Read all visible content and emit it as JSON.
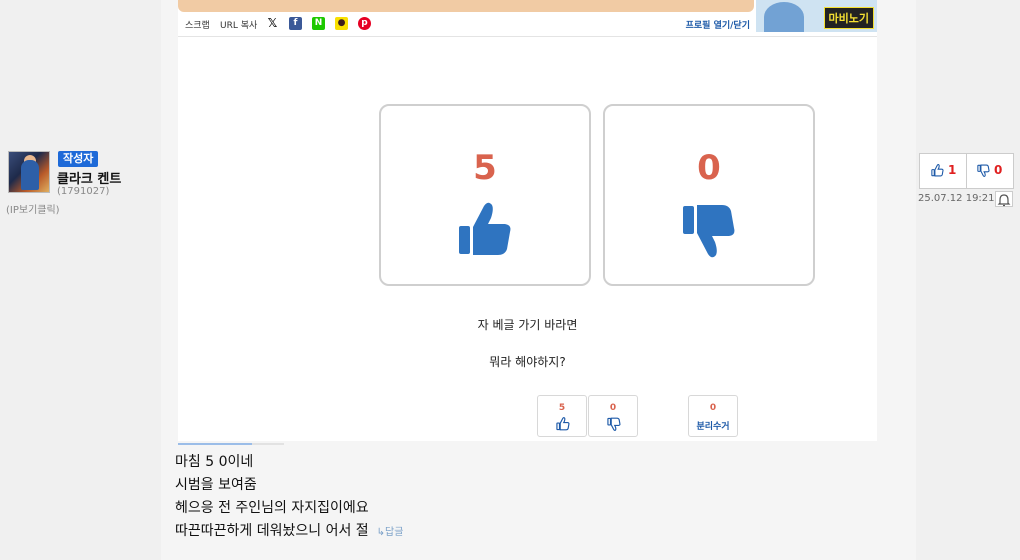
{
  "author": {
    "badge": "작성자",
    "name": "클라크 켄트",
    "id": "(1791027)",
    "ip_link": "(IP보기클릭)"
  },
  "article": {
    "share": {
      "scrap": "스크랩",
      "copy_url": "URL 복사",
      "icons": [
        "x-icon",
        "facebook-icon",
        "naver-icon",
        "kakaotalk-icon",
        "pinterest-icon"
      ],
      "profile_toggle": "프로필 열기/닫기"
    },
    "ad_text": "마비노기",
    "vote_up": "5",
    "vote_down": "0",
    "caption_line1": "자 베글 가기 바라면",
    "caption_line2": "뭐라 해야하지?",
    "mini_buttons": {
      "up": "5",
      "down": "0",
      "recycle_count": "0",
      "recycle_label": "분리수거"
    },
    "read_progress": 0.7
  },
  "comment": {
    "lines": [
      "마침 5 0이네",
      "시범을 보여줌",
      "헤으응 전 주인님의 자지집이에요",
      "따끈따끈하게 데워놨으니 어서 절"
    ],
    "reply_label": "↳답글",
    "vote_up": "1",
    "vote_down": "0",
    "date": "25.07.12 19:21"
  },
  "colors": {
    "accent_blue": "#1e6ad8",
    "vote_red": "#d9634e",
    "thumb_blue": "#2f74c0"
  }
}
